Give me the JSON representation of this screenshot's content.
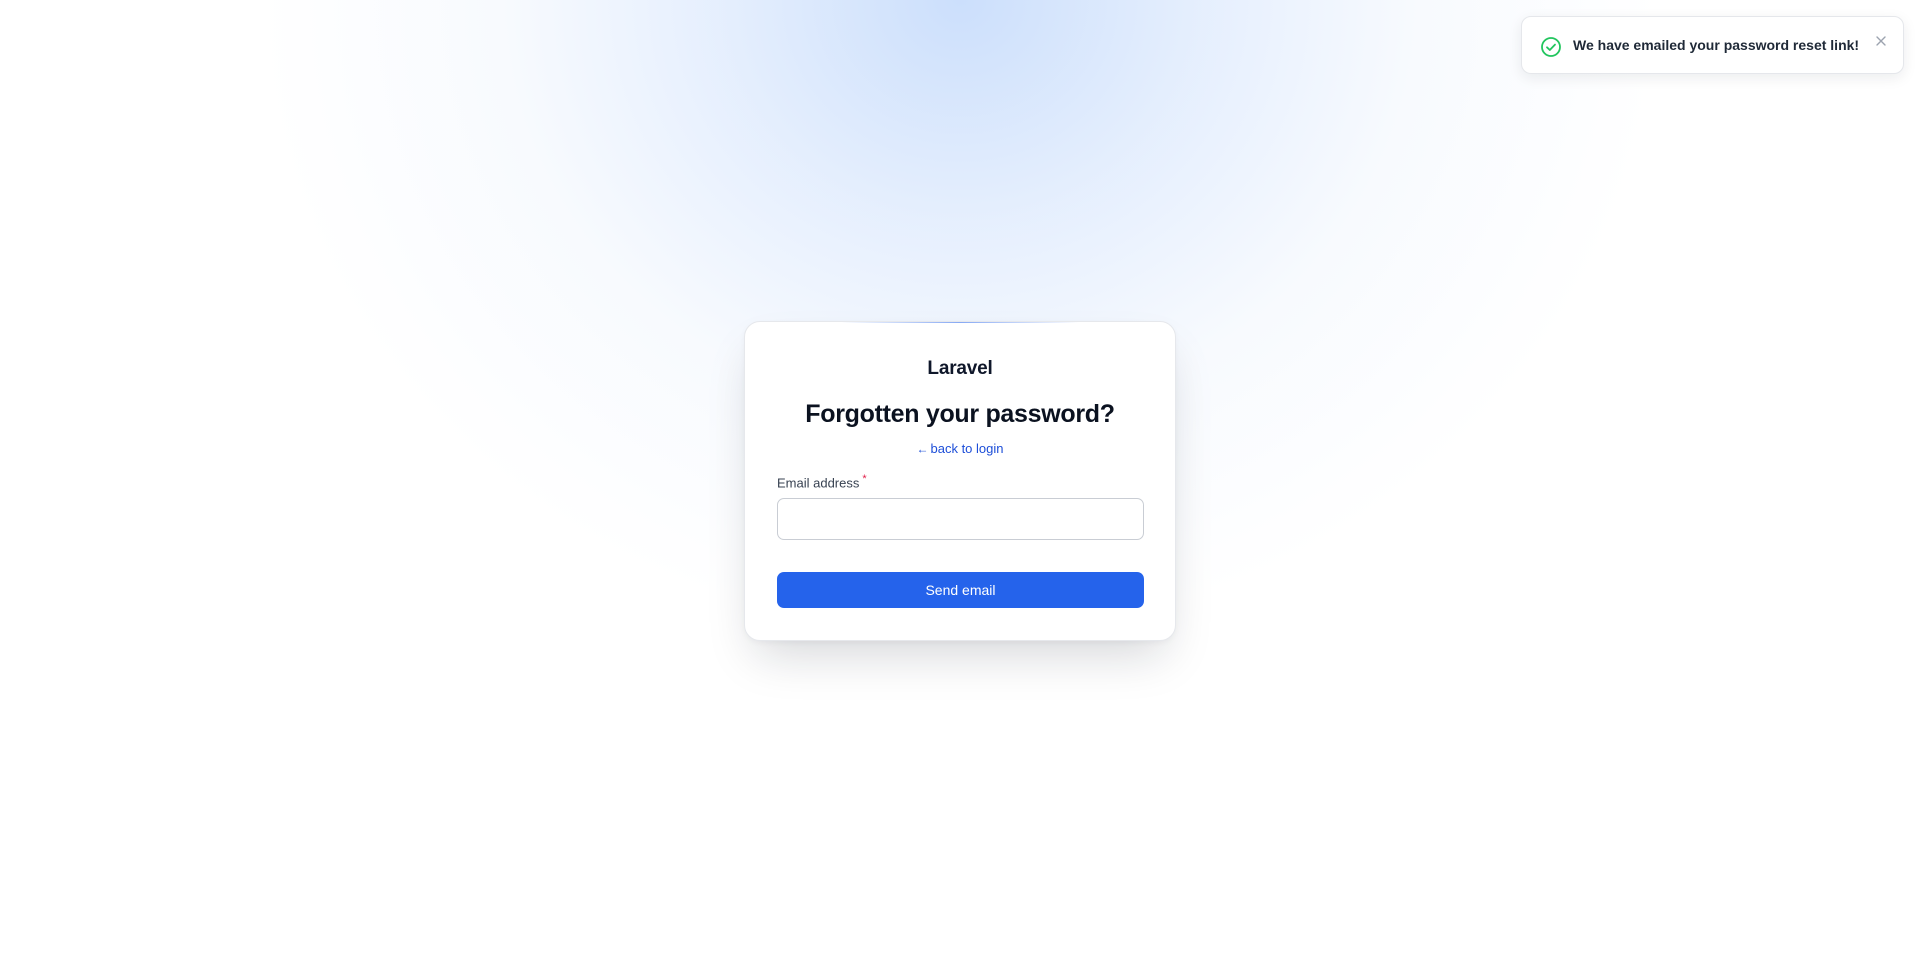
{
  "card": {
    "brand": "Laravel",
    "heading": "Forgotten your password?",
    "back_link": {
      "arrow": "←",
      "label": "back to login"
    },
    "email_field": {
      "label": "Email address",
      "required_mark": "*",
      "value": "",
      "placeholder": ""
    },
    "submit_label": "Send email"
  },
  "toast": {
    "message": "We have emailed your password reset link!",
    "status_icon": "check-circle-icon",
    "close_icon": "close-icon"
  },
  "colors": {
    "accent": "#2563eb",
    "link": "#1d4ed8",
    "success": "#22c55e",
    "required": "#e11d48"
  }
}
